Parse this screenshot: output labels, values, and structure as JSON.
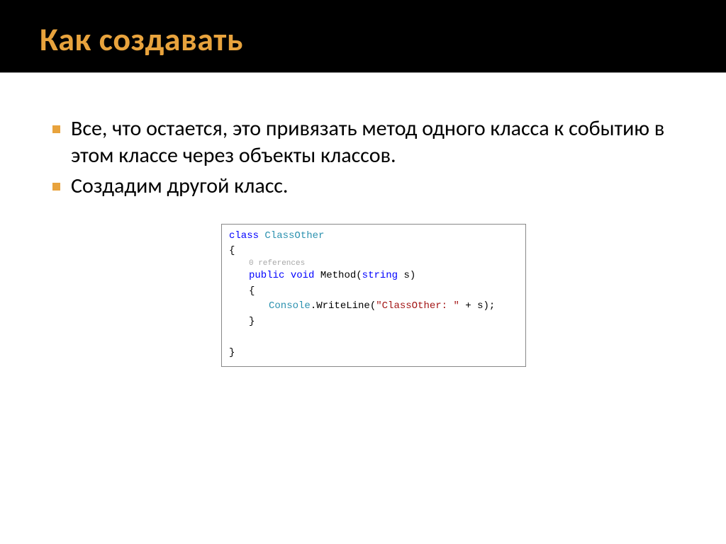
{
  "title": "Как создавать",
  "bullets": [
    "Все, что остается, это привязать метод одного класса к событию в этом классе через объекты классов.",
    "Создадим другой класс."
  ],
  "code": {
    "kw_class": "class",
    "class_name": "ClassOther",
    "open_brace": "{",
    "references": "0 references",
    "kw_public": "public",
    "kw_void": "void",
    "method_name": "Method",
    "open_paren": "(",
    "kw_string": "string",
    "param": " s)",
    "body_open": "{",
    "console": "Console",
    "writeline": ".WriteLine(",
    "string_literal": "\"ClassOther: \"",
    "concat": " + s);",
    "body_close": "}",
    "close_brace": "}"
  }
}
